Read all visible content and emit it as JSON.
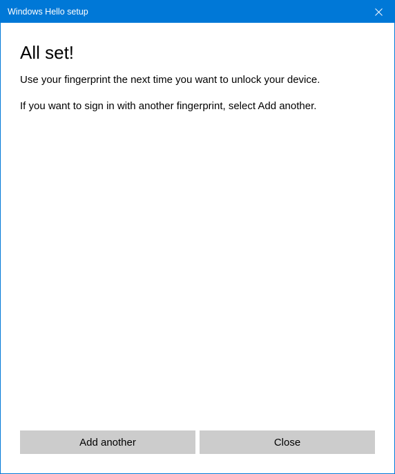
{
  "titlebar": {
    "title": "Windows Hello setup"
  },
  "content": {
    "heading": "All set!",
    "paragraph1": "Use your fingerprint the next time you want to unlock your device.",
    "paragraph2": "If you want to sign in with another fingerprint, select Add another."
  },
  "footer": {
    "add_another_label": "Add another",
    "close_label": "Close"
  }
}
